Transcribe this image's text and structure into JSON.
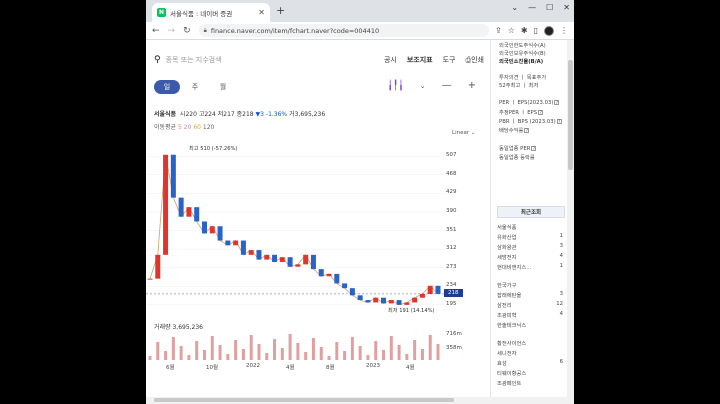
{
  "browser": {
    "tab_title": "서울식품 : 네이버 증권",
    "tab_icon": "N",
    "url": "finance.naver.com/item/fchart.naver?code=004410"
  },
  "search": {
    "placeholder": "종목 또는 지수검색"
  },
  "menu": {
    "links": [
      "공시",
      "보조지표",
      "도구",
      "인쇄"
    ]
  },
  "period_tabs": [
    "일",
    "주",
    "월"
  ],
  "info": {
    "name": "서울식품",
    "open_label": "시",
    "open": "220",
    "high_label": "고",
    "high": "224",
    "low_label": "저",
    "low": "217",
    "close_label": "종",
    "close": "218",
    "change": "▼3",
    "change_pct": "-1.36%",
    "volume_label": "거",
    "volume": "3,695,236"
  },
  "moving_avg": {
    "label": "이동평균",
    "periods": [
      "5",
      "20",
      "60",
      "120"
    ]
  },
  "scale_mode": "Linear ⌄",
  "chart_data": {
    "type": "line",
    "y_ticks": [
      "507",
      "468",
      "429",
      "390",
      "351",
      "312",
      "273",
      "234",
      "195"
    ],
    "ylim": [
      180,
      520
    ],
    "current_price": "218",
    "max_label": "최고 510 (-57.26%)",
    "min_label": "최저 191 (14.14%)",
    "volume_label": "거래량 3,695,236",
    "volume_ticks": [
      "716m",
      "358m"
    ],
    "x_ticks": [
      "6월",
      "10월",
      "2022",
      "4월",
      "8월",
      "2023",
      "4월"
    ],
    "series": [
      {
        "values": [
          250,
          300,
          510,
          420,
          380,
          400,
          370,
          345,
          360,
          330,
          320,
          330,
          300,
          310,
          290,
          300,
          285,
          295,
          275,
          280,
          300,
          270,
          255,
          260,
          240,
          230,
          215,
          205,
          200,
          210,
          198,
          205,
          195,
          200,
          210,
          218,
          235,
          218
        ]
      }
    ]
  },
  "right_panel": {
    "top_items": [
      "외국인한도주식수(A)",
      "외국인보유주식수(B)",
      "외국인소진율(B/A)"
    ],
    "invest_items": [
      "투자의견 ㅣ 목표주가",
      "52주최고 ㅣ 최저"
    ],
    "ratio_items": [
      "PER ㅣ EPS(2023.03)",
      "추정PER ㅣ EPS",
      "PBR ㅣ BPS (2023.03)",
      "배당수익률"
    ],
    "sector_items": [
      "동일업종 PER",
      "동일업종 등락률"
    ],
    "recent_header": "최근조회",
    "recent": [
      {
        "name": "서울식품",
        "n": ""
      },
      {
        "name": "유화산업",
        "n": "1"
      },
      {
        "name": "삼화왕관",
        "n": "3"
      },
      {
        "name": "세방전지",
        "n": "4"
      },
      {
        "name": "현대비앤지스...",
        "n": "1"
      },
      {
        "name": "한국가구",
        "n": ""
      },
      {
        "name": "잡래에탄올",
        "n": "3"
      },
      {
        "name": "삼전리",
        "n": "12"
      },
      {
        "name": "조광피혁",
        "n": "4"
      },
      {
        "name": "한솔테크닉스",
        "n": ""
      },
      {
        "name": "황전사이언스",
        "n": ""
      },
      {
        "name": "세니전자",
        "n": ""
      },
      {
        "name": "효성",
        "n": "6"
      },
      {
        "name": "티웨이항공스",
        "n": ""
      },
      {
        "name": "조광페인트",
        "n": ""
      }
    ]
  }
}
